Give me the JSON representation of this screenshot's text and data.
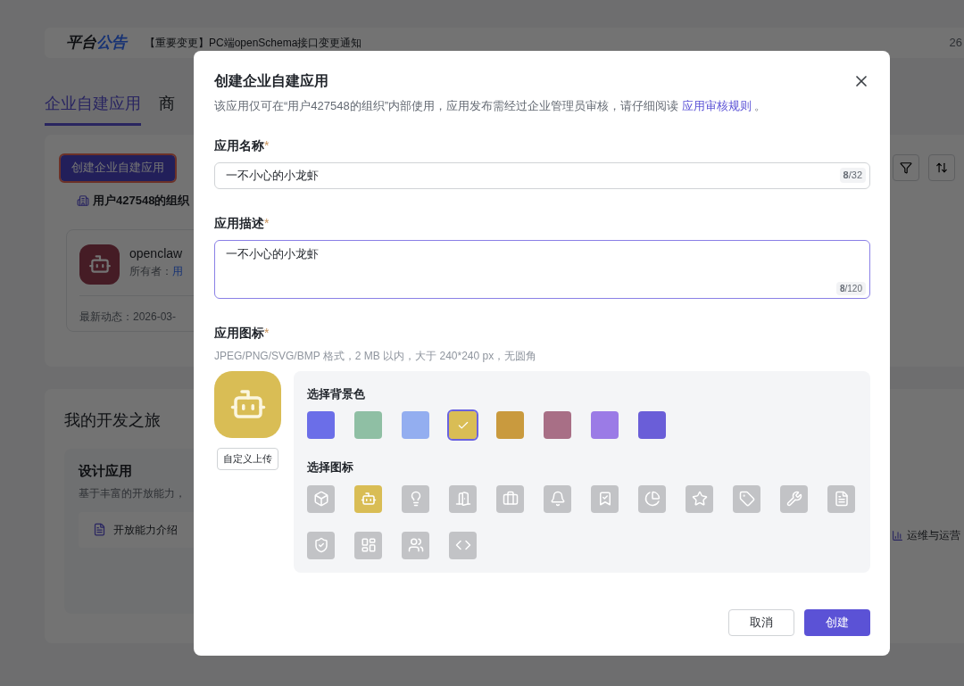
{
  "announcement": {
    "title_part1": "平台",
    "title_part2": "公告",
    "text": "【重要变更】PC端openSchema接口变更通知",
    "date": "26"
  },
  "tabs": [
    {
      "label": "企业自建应用",
      "selected": true
    },
    {
      "label": "商",
      "selected": false
    }
  ],
  "create_button": "创建企业自建应用",
  "org": {
    "name": "用户427548的组织"
  },
  "app_card": {
    "name": "openclaw",
    "owner_label": "所有者：",
    "owner": "用",
    "activity": "最新动态：2026-03-"
  },
  "journey": {
    "title": "我的开发之旅",
    "card_title": "设计应用",
    "card_desc": "基于丰富的开放能力，",
    "link": "开放能力介绍",
    "right_link": "运维与运营"
  },
  "dialog": {
    "title": "创建企业自建应用",
    "subtitle": "该应用仅可在“用户427548的组织”内部使用，应用发布需经过企业管理员审核，请仔细阅读 ",
    "subtitle_link": "应用审核规则",
    "subtitle_end": " 。",
    "name_field": {
      "label": "应用名称",
      "mark": "*",
      "value": "一不小心的小龙虾",
      "counter": "**8**/32"
    },
    "desc_field": {
      "label": "应用描述",
      "mark": "*",
      "value": "一不小心的小龙虾",
      "counter": "**8**/120"
    },
    "icon_field": {
      "label": "应用图标",
      "mark": "*",
      "hint": "JPEG/PNG/SVG/BMP 格式，2 MB 以内，大于 240*240 px，无圆角"
    },
    "upload_button": "自定义上传",
    "bg_title": "选择背景色",
    "colors": [
      {
        "color": "#6b6ee8",
        "selected": false
      },
      {
        "color": "#8fbfa4",
        "selected": false
      },
      {
        "color": "#93aef0",
        "selected": false
      },
      {
        "color": "#d9bd55",
        "selected": true
      },
      {
        "color": "#c99a3e",
        "selected": false
      },
      {
        "color": "#a86f86",
        "selected": false
      },
      {
        "color": "#9b7be6",
        "selected": false
      },
      {
        "color": "#6a5ed8",
        "selected": false
      }
    ],
    "icon_title": "选择图标",
    "icons": [
      {
        "selected": false
      },
      {
        "selected": true
      },
      {
        "selected": false
      },
      {
        "selected": false
      },
      {
        "selected": false
      },
      {
        "selected": false
      },
      {
        "selected": false
      },
      {
        "selected": false
      },
      {
        "selected": false
      },
      {
        "selected": false
      },
      {
        "selected": false
      },
      {
        "selected": false
      },
      {
        "selected": false
      },
      {
        "selected": false
      },
      {
        "selected": false
      },
      {
        "selected": false
      }
    ],
    "cancel": "取消",
    "confirm": "创建"
  }
}
